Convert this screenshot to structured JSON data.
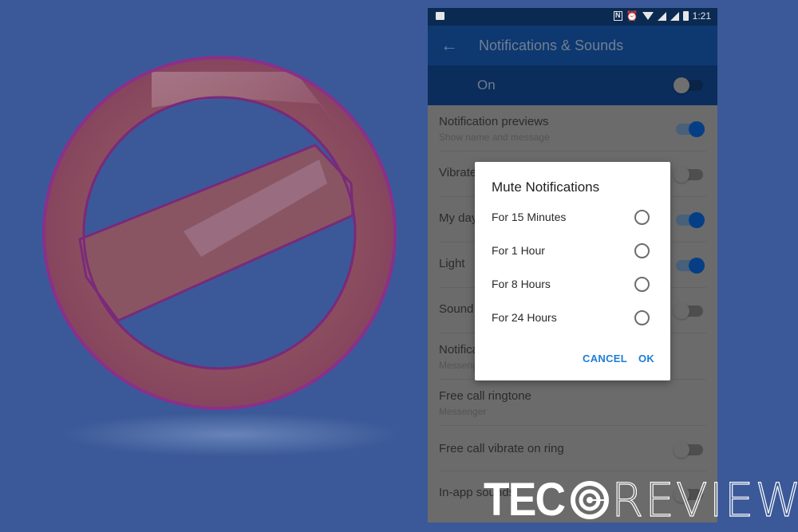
{
  "background": {
    "color": "#3b5998"
  },
  "illustration": {
    "icon": "prohibited-sign-icon",
    "color": "#8a4a5e"
  },
  "phone": {
    "status_bar": {
      "time": "1:21",
      "icons": [
        "image-icon",
        "nfc-icon",
        "alarm-icon",
        "wifi-icon",
        "signal-icon",
        "signal-icon",
        "battery-charging-icon"
      ]
    },
    "app_bar": {
      "back_icon": "back-arrow-icon",
      "title": "Notifications & Sounds"
    },
    "master_toggle": {
      "label": "On",
      "state": "off"
    },
    "settings": [
      {
        "title": "Notification previews",
        "subtitle": "Show name and message",
        "toggle": "on"
      },
      {
        "title": "Vibrate",
        "subtitle": "",
        "toggle": "off"
      },
      {
        "title": "My day",
        "subtitle": "",
        "toggle": "on"
      },
      {
        "title": "Light",
        "subtitle": "",
        "toggle": "on"
      },
      {
        "title": "Sound",
        "subtitle": "",
        "toggle": "off"
      },
      {
        "title": "Notification sound",
        "subtitle": "Messenger",
        "toggle": null
      },
      {
        "title": "Free call ringtone",
        "subtitle": "Messenger",
        "toggle": null
      },
      {
        "title": "Free call vibrate on ring",
        "subtitle": "",
        "toggle": "off"
      },
      {
        "title": "In-app sounds",
        "subtitle": "",
        "toggle": "off"
      }
    ]
  },
  "dialog": {
    "title": "Mute Notifications",
    "options": [
      {
        "label": "For 15 Minutes",
        "selected": false
      },
      {
        "label": "For 1 Hour",
        "selected": false
      },
      {
        "label": "For 8 Hours",
        "selected": false
      },
      {
        "label": "For 24 Hours",
        "selected": false
      }
    ],
    "cancel_label": "CANCEL",
    "ok_label": "OK",
    "accent_color": "#1d7ed6"
  },
  "watermark": {
    "part1": "TEC",
    "part2": "REVIEWS"
  },
  "colors": {
    "toggle_on": "#063e86",
    "app_bar": "#0e3870",
    "status_bar": "#0b2a52"
  }
}
